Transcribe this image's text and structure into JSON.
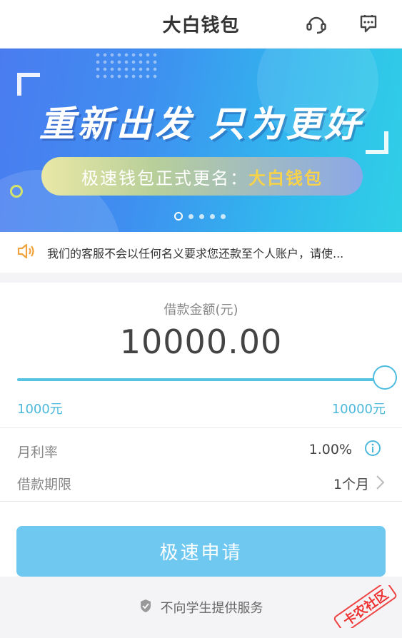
{
  "header": {
    "title": "大白钱包",
    "left_action_icon": "customer-service-icon",
    "right_action_icon": "message-icon"
  },
  "banner": {
    "headline": "重新出发 只为更好",
    "pill_text": "极速钱包正式更名：",
    "pill_highlight": "大白钱包",
    "pages": 5,
    "active_page": 1
  },
  "notice": {
    "icon": "speaker-icon",
    "text": "我们的客服不会以任何名义要求您还款至个人账户，请使..."
  },
  "loan": {
    "label": "借款金额(元)",
    "amount": "10000.00",
    "slider_min_label": "1000元",
    "slider_max_label": "10000元",
    "slider_fraction": 1.0
  },
  "rate": {
    "label": "月利率",
    "value": "1.00%"
  },
  "term": {
    "label": "借款期限",
    "value": "1个月"
  },
  "apply_button": "极速申请",
  "footer_note": "不向学生提供服务",
  "watermark": {
    "text": "卡农社区"
  },
  "colors": {
    "accent": "#57c3e3",
    "button": "#6ec8f0",
    "notice_icon": "#f0a33a",
    "pill_highlight": "#f7d24a"
  }
}
